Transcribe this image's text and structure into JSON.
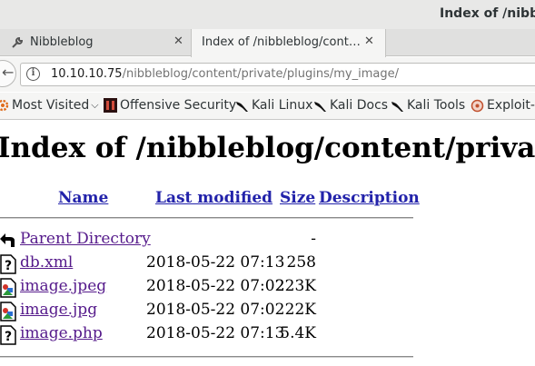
{
  "window": {
    "title": "Index of /nibble"
  },
  "tabs": [
    {
      "label": "Nibbleblog",
      "active": false
    },
    {
      "label": "Index of /nibbleblog/cont…",
      "active": true
    }
  ],
  "new_tab_symbol": "+",
  "urlbar": {
    "host": "10.10.10.75",
    "path": "/nibbleblog/content/private/plugins/my_image/"
  },
  "bookmarks": [
    {
      "label": "Most Visited",
      "icon": "gear-icon"
    },
    {
      "label": "Offensive Security",
      "icon": "offsec-icon"
    },
    {
      "label": "Kali Linux",
      "icon": "kali-dragon-icon"
    },
    {
      "label": "Kali Docs",
      "icon": "kali-dragon-icon"
    },
    {
      "label": "Kali Tools",
      "icon": "kali-dragon-icon"
    },
    {
      "label": "Exploit-D",
      "icon": "exploit-db-icon"
    }
  ],
  "page": {
    "heading": "Index of /nibbleblog/content/priva",
    "columns": {
      "name": "Name",
      "last_modified": "Last modified",
      "size": "Size",
      "description": "Description"
    },
    "rows": [
      {
        "name": "Parent Directory",
        "date": "",
        "size": "-",
        "icon": "parent-directory-icon"
      },
      {
        "name": "db.xml",
        "date": "2018-05-22 07:13",
        "size": "258",
        "icon": "unknown-file-icon"
      },
      {
        "name": "image.jpeg",
        "date": "2018-05-22 07:02",
        "size": "223K",
        "icon": "image-file-icon"
      },
      {
        "name": "image.jpg",
        "date": "2018-05-22 07:02",
        "size": "22K",
        "icon": "image-file-icon"
      },
      {
        "name": "image.php",
        "date": "2018-05-22 07:13",
        "size": "5.4K",
        "icon": "unknown-file-icon"
      }
    ]
  }
}
